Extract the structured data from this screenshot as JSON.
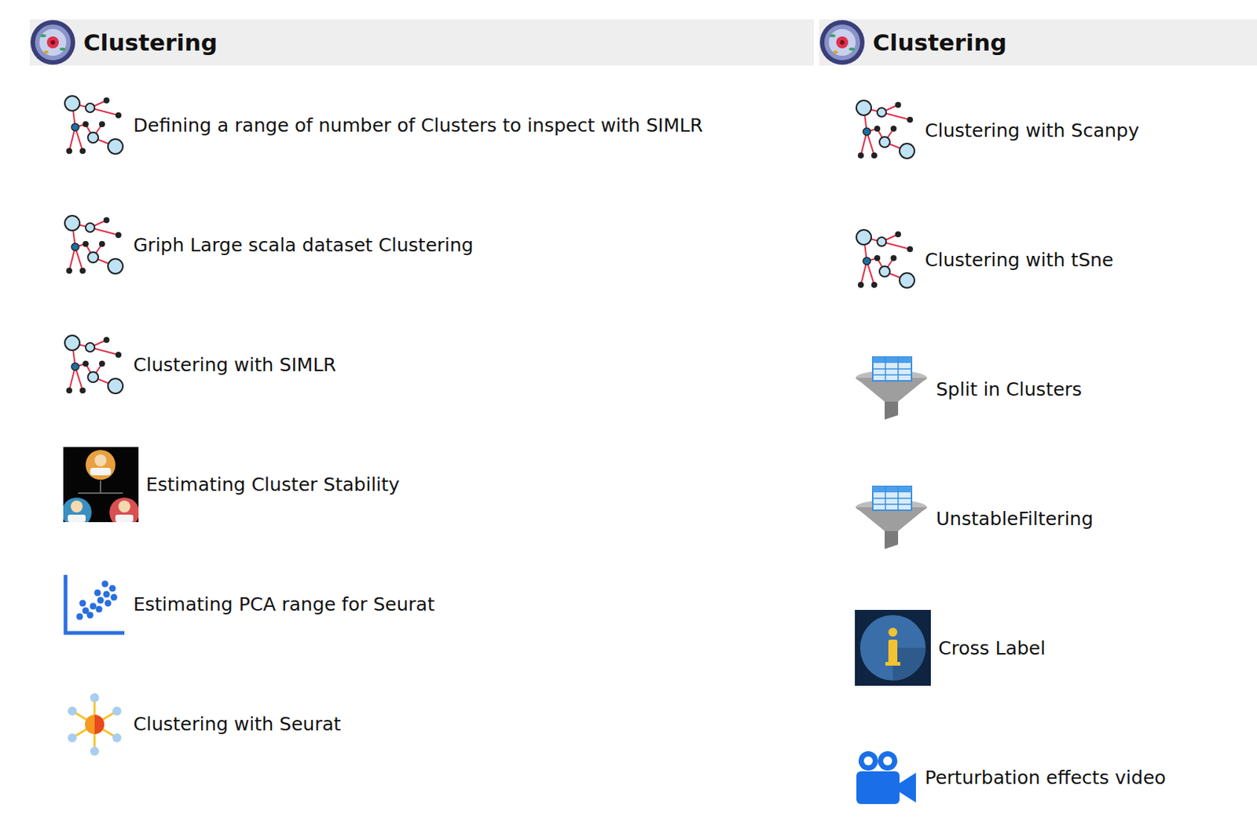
{
  "panels": [
    {
      "title": "Clustering",
      "items": [
        {
          "label": "Defining a range of number of Clusters to inspect with SIMLR"
        },
        {
          "label": "Griph Large scala dataset Clustering"
        },
        {
          "label": "Clustering with SIMLR"
        },
        {
          "label": "Estimating Cluster Stability"
        },
        {
          "label": "Estimating PCA range for Seurat"
        },
        {
          "label": "Clustering with Seurat"
        }
      ]
    },
    {
      "title": "Clustering",
      "items": [
        {
          "label": "Clustering with Scanpy"
        },
        {
          "label": "Clustering with tSne"
        },
        {
          "label": "Split in Clusters"
        },
        {
          "label": "UnstableFiltering"
        },
        {
          "label": "Cross Label"
        },
        {
          "label": "Perturbation effects video"
        }
      ]
    }
  ]
}
